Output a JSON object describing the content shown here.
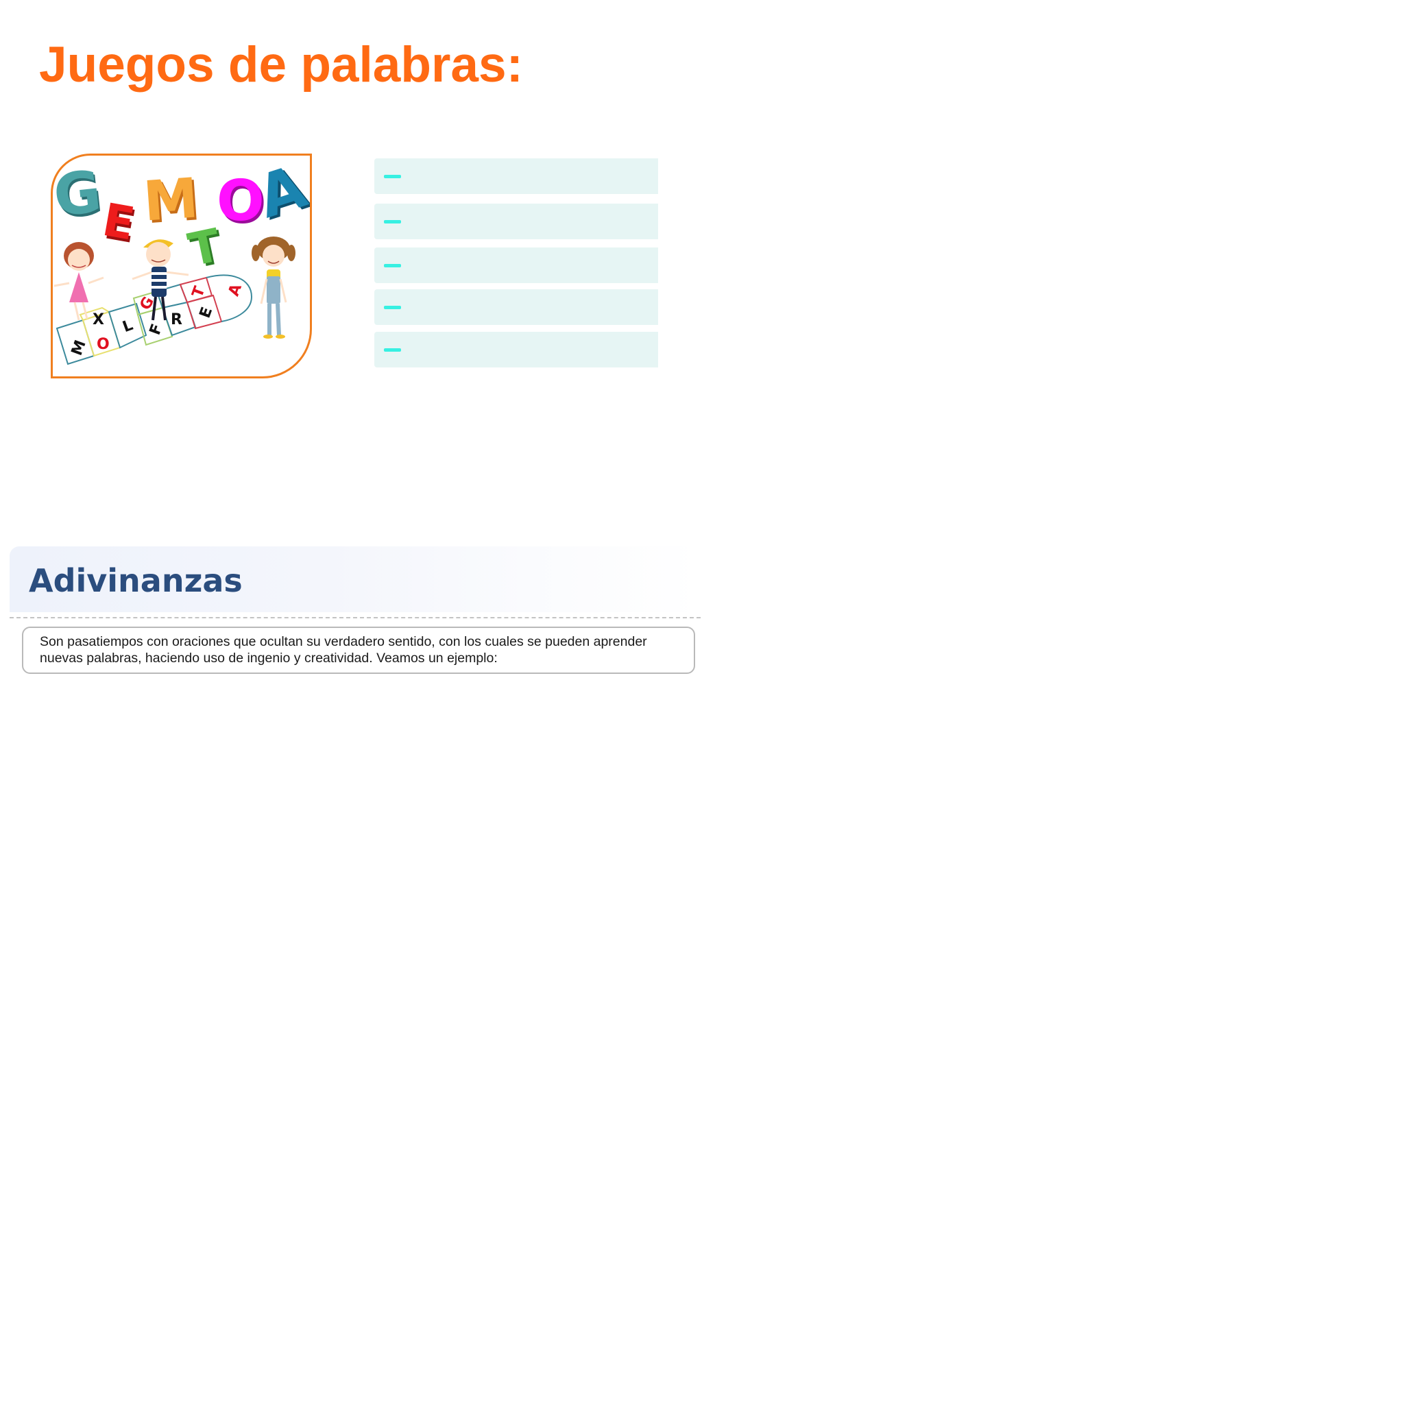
{
  "page": {
    "title": "Juegos de palabras:"
  },
  "illustration": {
    "letters": [
      "G",
      "E",
      "M",
      "T",
      "O",
      "A"
    ],
    "hopscotch_letters": [
      "M",
      "O",
      "X",
      "L",
      "F",
      "G",
      "R",
      "E",
      "T",
      "A"
    ]
  },
  "list_items": [
    {
      "text": ""
    },
    {
      "text": ""
    },
    {
      "text": ""
    },
    {
      "text": ""
    },
    {
      "text": ""
    }
  ],
  "section": {
    "title": "Adivinanzas",
    "definition": "Son pasatiempos con oraciones que ocultan su verdadero sentido, con los cuales se pueden aprender nuevas palabras, haciendo uso de ingenio y creatividad. Veamos un ejemplo:"
  },
  "colors": {
    "title_orange": "#ff6a13",
    "section_blue": "#2b4d7e",
    "row_background": "#e6f5f4",
    "dash_cyan": "#37f0e2",
    "frame_orange": "#f07f1f"
  }
}
